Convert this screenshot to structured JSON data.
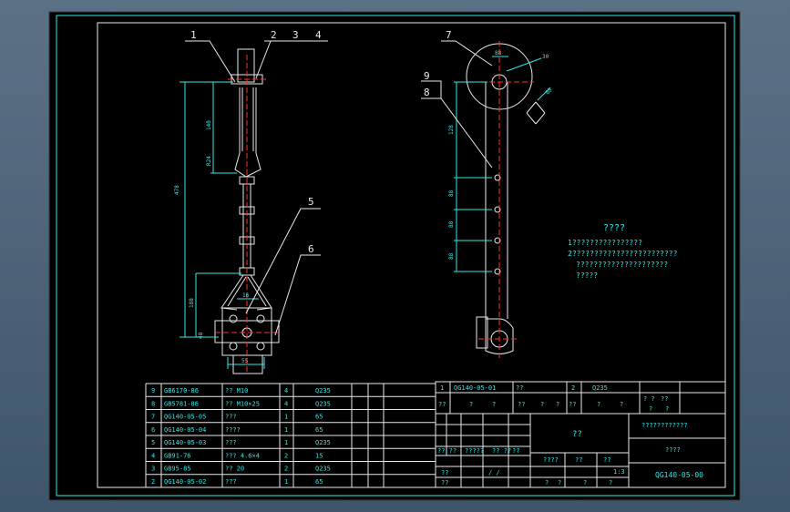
{
  "callouts": [
    "1",
    "2",
    "3",
    "4",
    "5",
    "6",
    "7",
    "8",
    "9"
  ],
  "dimensions": {
    "left_view": [
      "478",
      "140",
      "R24",
      "188",
      "16",
      "55",
      "48"
    ],
    "right_view": [
      "88",
      "128",
      "30",
      "88",
      "88",
      "88",
      "68"
    ]
  },
  "notes": {
    "title": "????",
    "lines": [
      "1????????????????",
      "2????????????????????????",
      "?????????????????????",
      "?????"
    ]
  },
  "parts_list": [
    {
      "no": "9",
      "code": "GB6170-86",
      "name": "?? M10",
      "qty": "4",
      "material": "Q235"
    },
    {
      "no": "8",
      "code": "GB5781-86",
      "name": "?? M10×25",
      "qty": "4",
      "material": "Q235"
    },
    {
      "no": "7",
      "code": "QG140-05-05",
      "name": "???",
      "qty": "1",
      "material": "65"
    },
    {
      "no": "6",
      "code": "QG140-05-04",
      "name": "????",
      "qty": "1",
      "material": "65"
    },
    {
      "no": "5",
      "code": "QG140-05-03",
      "name": "???",
      "qty": "1",
      "material": "Q235"
    },
    {
      "no": "4",
      "code": "GB91-76",
      "name": "??? 4.6×4",
      "qty": "2",
      "material": "15"
    },
    {
      "no": "3",
      "code": "GB95-85",
      "name": "?? 20",
      "qty": "2",
      "material": "Q235"
    },
    {
      "no": "2",
      "code": "QG140-05-02",
      "name": "???",
      "qty": "1",
      "material": "65"
    }
  ],
  "title_block": {
    "top_row": {
      "no": "1",
      "code": "QG140-05-01",
      "name": "??",
      "qty": "2",
      "material": "Q235"
    },
    "header_row": [
      "??",
      "?",
      "?",
      "??",
      "?",
      "?",
      "??",
      "?",
      "?",
      "? ?",
      "??",
      "?",
      "?"
    ],
    "center": "??",
    "company_line": "????????????",
    "drawing_name": "????",
    "drawing_no": "QG140-05-00",
    "sign_rows": [
      "?? ??",
      "?????",
      "?? ??",
      "??"
    ],
    "scale_labels": [
      "????",
      "??",
      "??"
    ],
    "scale_value": "1:3",
    "sheet_labels": [
      "?",
      "?",
      "?",
      "?"
    ],
    "design_labels": [
      "??",
      "??",
      "/ /"
    ]
  }
}
